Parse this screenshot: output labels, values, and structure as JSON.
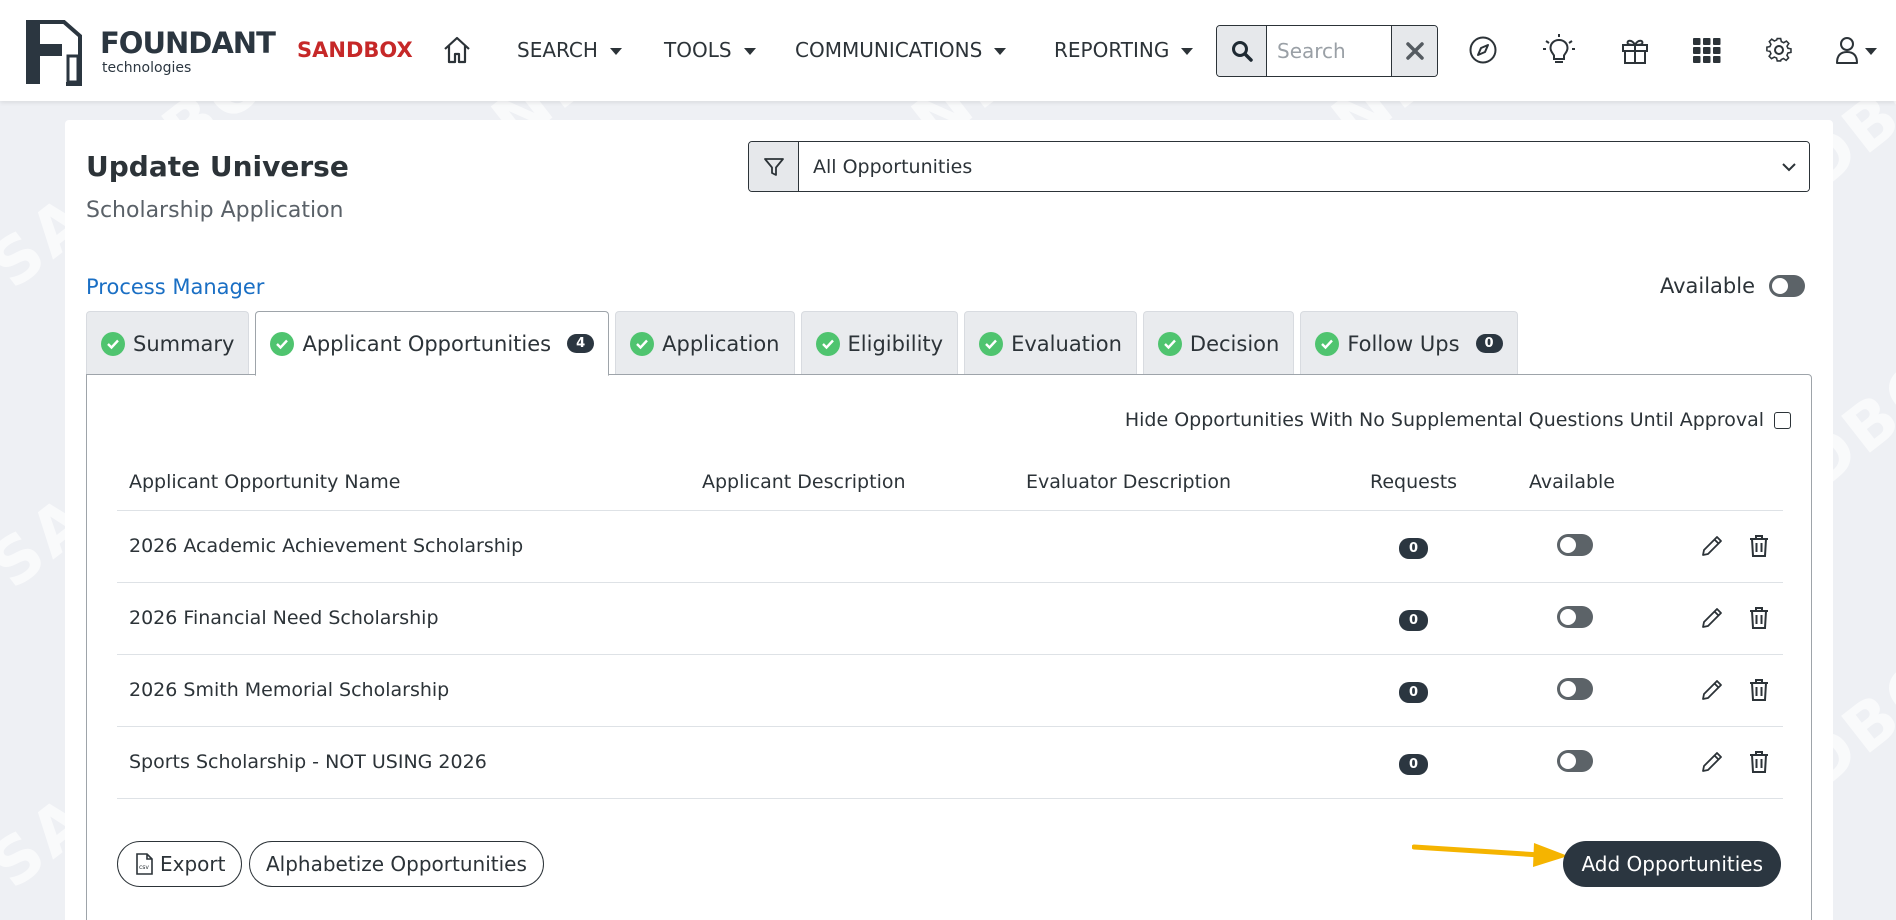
{
  "watermark_text": "SANDBOX",
  "header": {
    "logo_text": "FOUNDANT",
    "logo_subtext": "technologies",
    "environment": "SANDBOX",
    "nav": [
      {
        "label": "SEARCH"
      },
      {
        "label": "TOOLS"
      },
      {
        "label": "COMMUNICATIONS"
      },
      {
        "label": "REPORTING"
      }
    ],
    "search_placeholder": "Search"
  },
  "page": {
    "title": "Update Universe",
    "subtitle": "Scholarship Application",
    "filter_value": "All Opportunities",
    "process_manager_link": "Process Manager",
    "available_label": "Available"
  },
  "tabs": [
    {
      "label": "Summary",
      "badge": ""
    },
    {
      "label": "Applicant Opportunities",
      "badge": "4"
    },
    {
      "label": "Application",
      "badge": ""
    },
    {
      "label": "Eligibility",
      "badge": ""
    },
    {
      "label": "Evaluation",
      "badge": ""
    },
    {
      "label": "Decision",
      "badge": ""
    },
    {
      "label": "Follow Ups",
      "badge": "0"
    }
  ],
  "panel": {
    "hide_option_label": "Hide Opportunities With No Supplemental Questions Until Approval",
    "columns": [
      "Applicant Opportunity Name",
      "Applicant Description",
      "Evaluator Description",
      "Requests",
      "Available"
    ],
    "rows": [
      {
        "name": "2026 Academic Achievement Scholarship",
        "requests": "0"
      },
      {
        "name": "2026 Financial Need Scholarship",
        "requests": "0"
      },
      {
        "name": "2026 Smith Memorial Scholarship",
        "requests": "0"
      },
      {
        "name": "Sports Scholarship - NOT USING 2026",
        "requests": "0"
      }
    ],
    "export_label": "Export",
    "alphabetize_label": "Alphabetize Opportunities",
    "add_label": "Add Opportunities"
  },
  "colors": {
    "brand_dark": "#2b3640",
    "sandbox_red": "#c62828",
    "link_blue": "#1a6fc4",
    "check_green": "#4fc46f",
    "arrow_yellow": "#f5b400"
  }
}
